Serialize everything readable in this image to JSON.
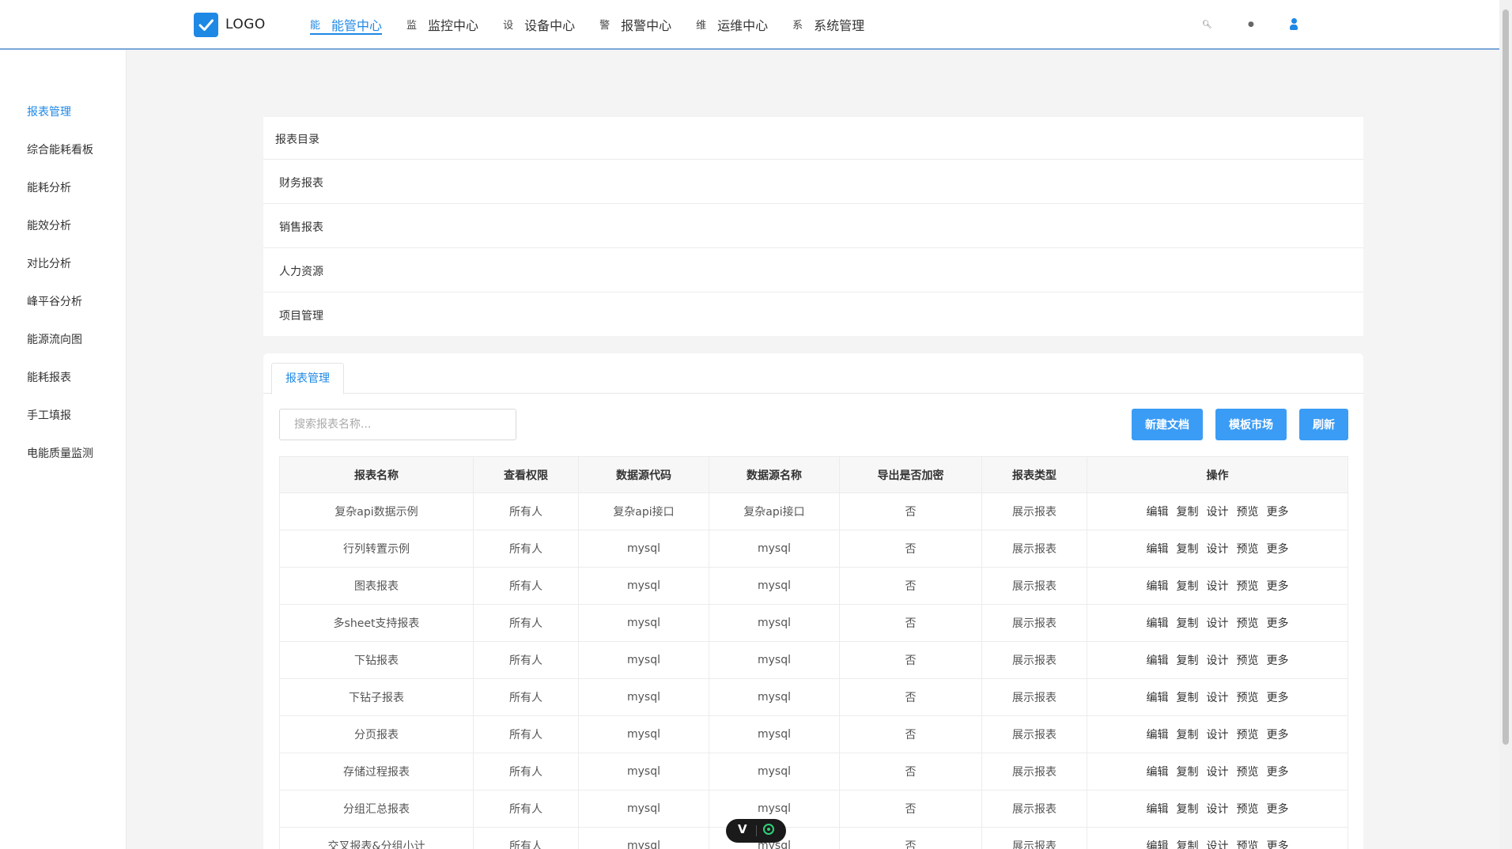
{
  "header": {
    "logo_text": "LOGO",
    "nav": [
      {
        "icon_char": "能",
        "label": "能管中心",
        "active": true
      },
      {
        "icon_char": "监",
        "label": "监控中心"
      },
      {
        "icon_char": "设",
        "label": "设备中心"
      },
      {
        "icon_char": "警",
        "label": "报警中心"
      },
      {
        "icon_char": "维",
        "label": "运维中心"
      },
      {
        "icon_char": "系",
        "label": "系统管理"
      }
    ],
    "icons": [
      "search-icon",
      "notification-icon",
      "user-icon"
    ]
  },
  "sidebar": {
    "items": [
      {
        "label": "报表管理",
        "active": true
      },
      {
        "label": "综合能耗看板"
      },
      {
        "label": "能耗分析"
      },
      {
        "label": "能效分析"
      },
      {
        "label": "对比分析"
      },
      {
        "label": "峰平谷分析"
      },
      {
        "label": "能源流向图"
      },
      {
        "label": "能耗报表"
      },
      {
        "label": "手工填报"
      },
      {
        "label": "电能质量监测"
      }
    ]
  },
  "catalog": {
    "title": "报表目录",
    "items": [
      "财务报表",
      "销售报表",
      "人力资源",
      "项目管理"
    ]
  },
  "manage": {
    "tab_label": "报表管理",
    "search_placeholder": "搜索报表名称...",
    "buttons": {
      "new": "新建文档",
      "market": "模板市场",
      "refresh": "刷新"
    },
    "columns": [
      "报表名称",
      "查看权限",
      "数据源代码",
      "数据源名称",
      "导出是否加密",
      "报表类型",
      "操作"
    ],
    "actions": [
      "编辑",
      "复制",
      "设计",
      "预览",
      "更多"
    ],
    "rows": [
      [
        "复杂api数据示例",
        "所有人",
        "复杂api接口",
        "复杂api接口",
        "否",
        "展示报表"
      ],
      [
        "行列转置示例",
        "所有人",
        "mysql",
        "mysql",
        "否",
        "展示报表"
      ],
      [
        "图表报表",
        "所有人",
        "mysql",
        "mysql",
        "否",
        "展示报表"
      ],
      [
        "多sheet支持报表",
        "所有人",
        "mysql",
        "mysql",
        "否",
        "展示报表"
      ],
      [
        "下钻报表",
        "所有人",
        "mysql",
        "mysql",
        "否",
        "展示报表"
      ],
      [
        "下钻子报表",
        "所有人",
        "mysql",
        "mysql",
        "否",
        "展示报表"
      ],
      [
        "分页报表",
        "所有人",
        "mysql",
        "mysql",
        "否",
        "展示报表"
      ],
      [
        "存储过程报表",
        "所有人",
        "mysql",
        "mysql",
        "否",
        "展示报表"
      ],
      [
        "分组汇总报表",
        "所有人",
        "mysql",
        "mysql",
        "否",
        "展示报表"
      ],
      [
        "交叉报表&分组小计",
        "所有人",
        "mysql",
        "mysql",
        "否",
        "展示报表"
      ]
    ]
  },
  "colors": {
    "accent": "#1e88e5",
    "button": "#3b9cf5"
  }
}
